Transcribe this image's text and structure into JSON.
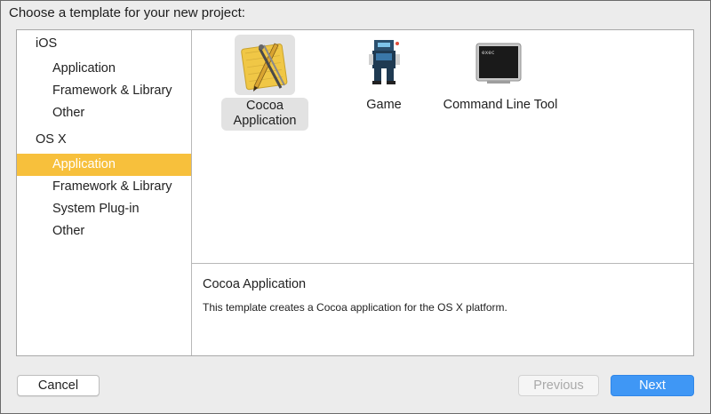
{
  "window": {
    "title": "Choose a template for your new project:"
  },
  "sidebar": {
    "sections": [
      {
        "label": "iOS",
        "items": [
          {
            "label": "Application",
            "selected": false
          },
          {
            "label": "Framework & Library",
            "selected": false
          },
          {
            "label": "Other",
            "selected": false
          }
        ]
      },
      {
        "label": "OS X",
        "items": [
          {
            "label": "Application",
            "selected": true
          },
          {
            "label": "Framework & Library",
            "selected": false
          },
          {
            "label": "System Plug-in",
            "selected": false
          },
          {
            "label": "Other",
            "selected": false
          }
        ]
      }
    ],
    "selection_color": "#f7c03c"
  },
  "templates": [
    {
      "label": "Cocoa Application",
      "icon": "cocoa-app-icon",
      "selected": true
    },
    {
      "label": "Game",
      "icon": "game-icon",
      "selected": false
    },
    {
      "label": "Command Line Tool",
      "icon": "terminal-icon",
      "selected": false,
      "icon_text": "exec"
    }
  ],
  "description": {
    "title": "Cocoa Application",
    "text": "This template creates a Cocoa application for the OS X platform."
  },
  "buttons": {
    "cancel": "Cancel",
    "previous": "Previous",
    "next": "Next",
    "next_color": "#3f97f5"
  }
}
